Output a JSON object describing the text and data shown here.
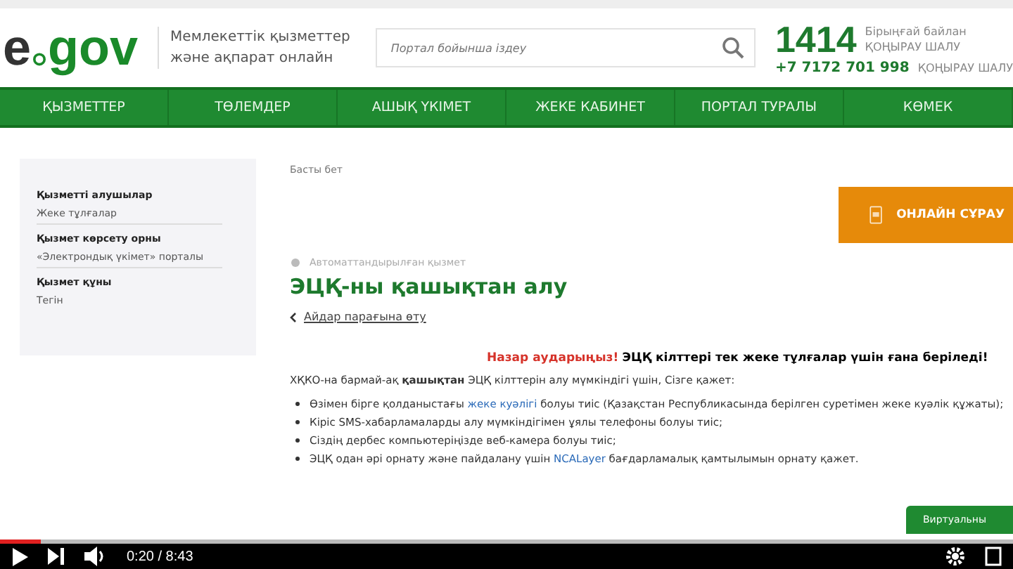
{
  "header": {
    "logo_left": "e",
    "logo_right": "gov",
    "tagline": [
      "Мемлекеттік қызметтер",
      "және ақпарат онлайн"
    ],
    "search": {
      "placeholder": "Портал бойынша іздеу"
    },
    "hotline": "1414",
    "hotline_note": [
      "Бірыңғай байлан",
      "ҚОҢЫРАУ ШАЛУ"
    ],
    "phone": "+7 7172 701 998",
    "phone_note": "ҚОҢЫРАУ ШАЛУ"
  },
  "nav": [
    "ҚЫЗМЕТТЕР",
    "ТӨЛЕМДЕР",
    "АШЫҚ ҮКІМЕТ",
    "ЖЕКЕ КАБИНЕТ",
    "ПОРТАЛ ТУРАЛЫ",
    "КӨМЕК"
  ],
  "sidebar": [
    {
      "label": "Қызметті алушылар",
      "value": "Жеке тұлғалар"
    },
    {
      "label": "Қызмет көрсету орны",
      "value": "«Электрондық үкімет» порталы"
    },
    {
      "label": "Қызмет құны",
      "value": "Тегін"
    }
  ],
  "breadcrumb": "Басты бет",
  "online_button": "ОНЛАЙН СҰРАУ",
  "service_type": "Автоматтандырылған қызмет",
  "title": "ЭЦҚ-ны қашықтан алу",
  "back_link": "Айдар парағына өту",
  "notice": {
    "label": "Назар аударыңыз!",
    "text": "ЭЦҚ кілттері тек жеке тұлғалар үшін ғана беріледі!"
  },
  "intro": "ХҚКО-на бармай-ақ **қашықтан** ЭЦҚ кілттерін алу мүмкіндігі үшін, Сізге қажет:",
  "bullets": [
    {
      "before": "Өзімен бірге қолданыстағы ",
      "link": "жеке куәлігі",
      "after": " болуы тиіс (Қазақстан Республикасында берілген суретімен жеке куәлік құжаты);"
    },
    {
      "before": "Кіріс SMS-хабарламаларды алу мүмкіндігімен ұялы телефоны болуы тиіс;"
    },
    {
      "before": "Сіздің дербес компьютеріңізде веб-камера болуы тиіс;"
    },
    {
      "before": "ЭЦҚ одан әрі орнату және пайдалану үшін ",
      "link": "NCALayer",
      "after": " бағдарламалық қамтылымын орнату қажет."
    }
  ],
  "virtual_button": "Виртуальны",
  "player": {
    "level": 0.04,
    "time": "0:20 / 8:43"
  }
}
